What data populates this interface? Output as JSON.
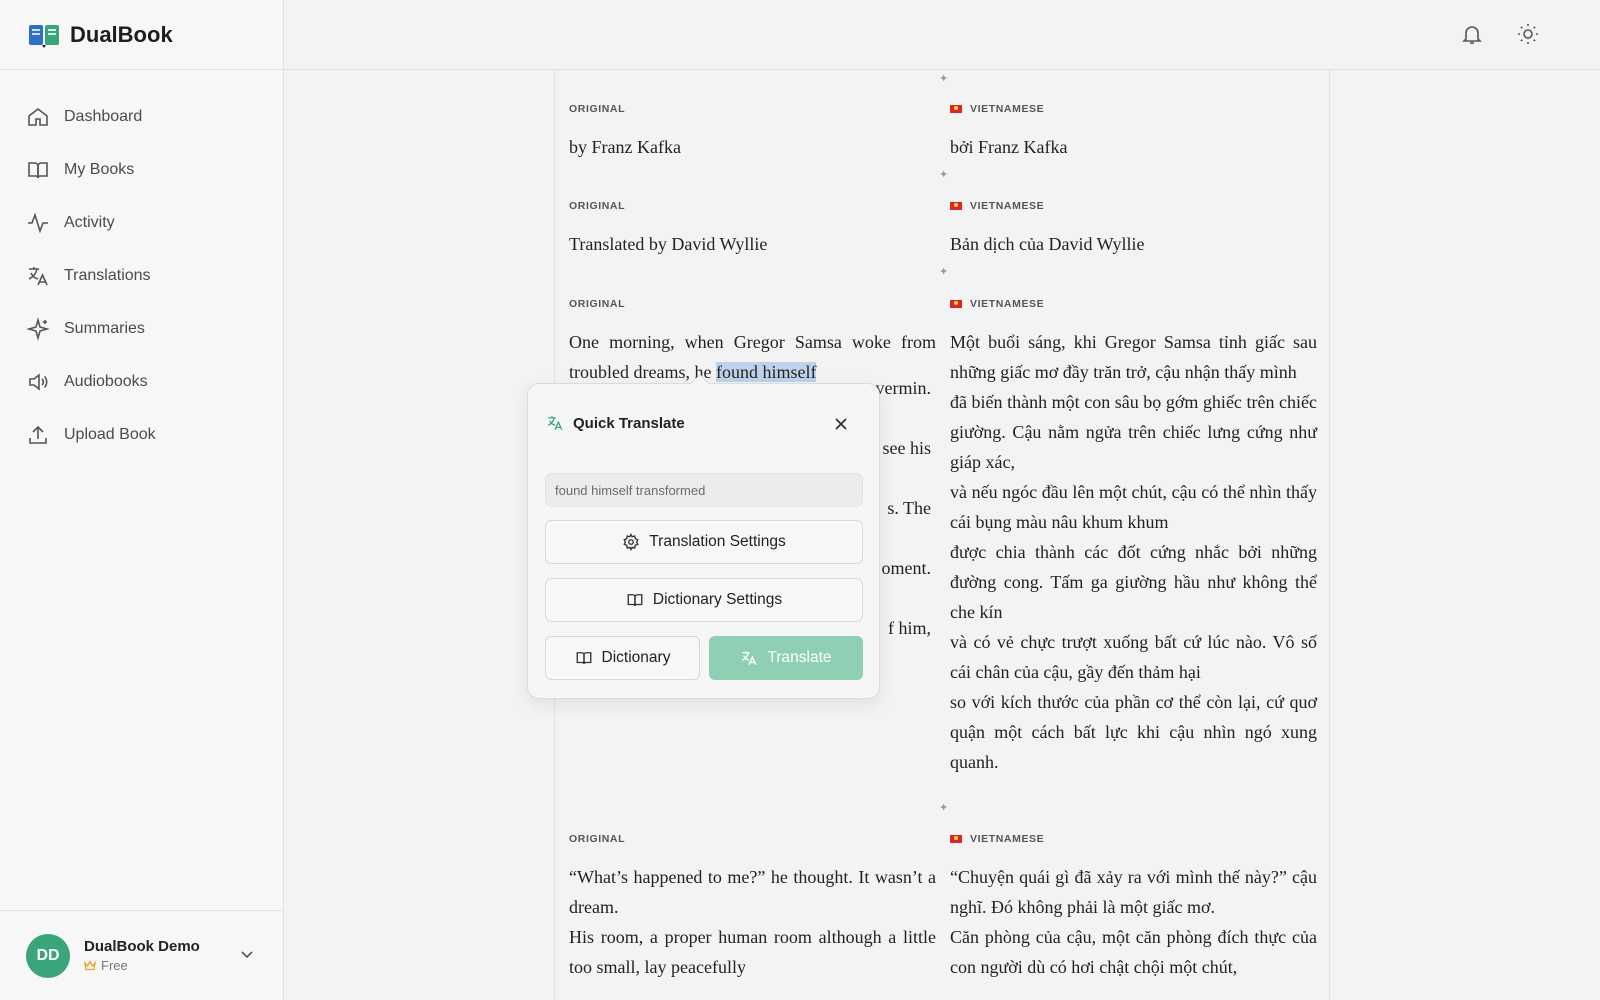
{
  "app": {
    "name": "DualBook"
  },
  "sidebar": {
    "items": [
      {
        "label": "Dashboard",
        "icon": "home-icon"
      },
      {
        "label": "My Books",
        "icon": "book-icon"
      },
      {
        "label": "Activity",
        "icon": "activity-icon"
      },
      {
        "label": "Translations",
        "icon": "translate-icon"
      },
      {
        "label": "Summaries",
        "icon": "sparkles-icon"
      },
      {
        "label": "Audiobooks",
        "icon": "speaker-icon"
      },
      {
        "label": "Upload Book",
        "icon": "upload-icon"
      }
    ]
  },
  "user": {
    "initials": "DD",
    "name": "DualBook Demo",
    "plan": "Free"
  },
  "reader": {
    "original_label": "ORIGINAL",
    "vietnamese_label": "VIETNAMESE",
    "paragraphs": [
      {
        "original": "by Franz Kafka",
        "vietnamese": "bởi Franz Kafka"
      },
      {
        "original": "Translated by David Wyllie",
        "vietnamese": "Bản dịch của David Wyllie"
      },
      {
        "original_before": "One morning, when Gregor Samsa woke from troubled dreams, he ",
        "original_highlight": "found himself",
        "original_line3_end": "vermin.",
        "original_line4_end": "see his",
        "original_line6_end": "s. The",
        "original_line8_end": "oment.",
        "original_line10_end": "f him,",
        "vietnamese": [
          "Một buổi sáng, khi Gregor Samsa tỉnh giấc sau những giấc mơ đầy trăn trở, cậu nhận thấy mình",
          "đã biến thành một con sâu bọ gớm ghiếc trên chiếc giường. Cậu nằm ngửa trên chiếc lưng cứng như giáp xác,",
          "và nếu ngóc đầu lên một chút, cậu có thể nhìn thấy cái bụng màu nâu khum khum",
          "được chia thành các đốt cứng nhắc bởi những đường cong. Tấm ga giường hầu như không thể che kín",
          "và có vẻ chực trượt xuống bất cứ lúc nào. Vô số cái chân của cậu, gầy đến thảm hại",
          "so với kích thước của phần cơ thể còn lại, cứ quơ quận một cách bất lực khi cậu nhìn ngó xung quanh."
        ]
      },
      {
        "original": [
          "“What’s happened to me?” he thought. It wasn’t a dream.",
          "His room, a proper human room although a little too small, lay peacefully"
        ],
        "vietnamese": [
          "“Chuyện quái gì đã xảy ra với mình thế này?” cậu nghĩ. Đó không phải là một giấc mơ.",
          "Căn phòng của cậu, một căn phòng đích thực của con người dù có hơi chật chội một chút,"
        ]
      }
    ]
  },
  "quick_translate": {
    "title": "Quick Translate",
    "input_value": "found himself transformed",
    "translation_settings_label": "Translation Settings",
    "dictionary_settings_label": "Dictionary Settings",
    "dictionary_label": "Dictionary",
    "translate_label": "Translate"
  },
  "colors": {
    "accent": "#8fd0b5",
    "avatar": "#3aa57a",
    "highlight": "#bcd3ea"
  }
}
